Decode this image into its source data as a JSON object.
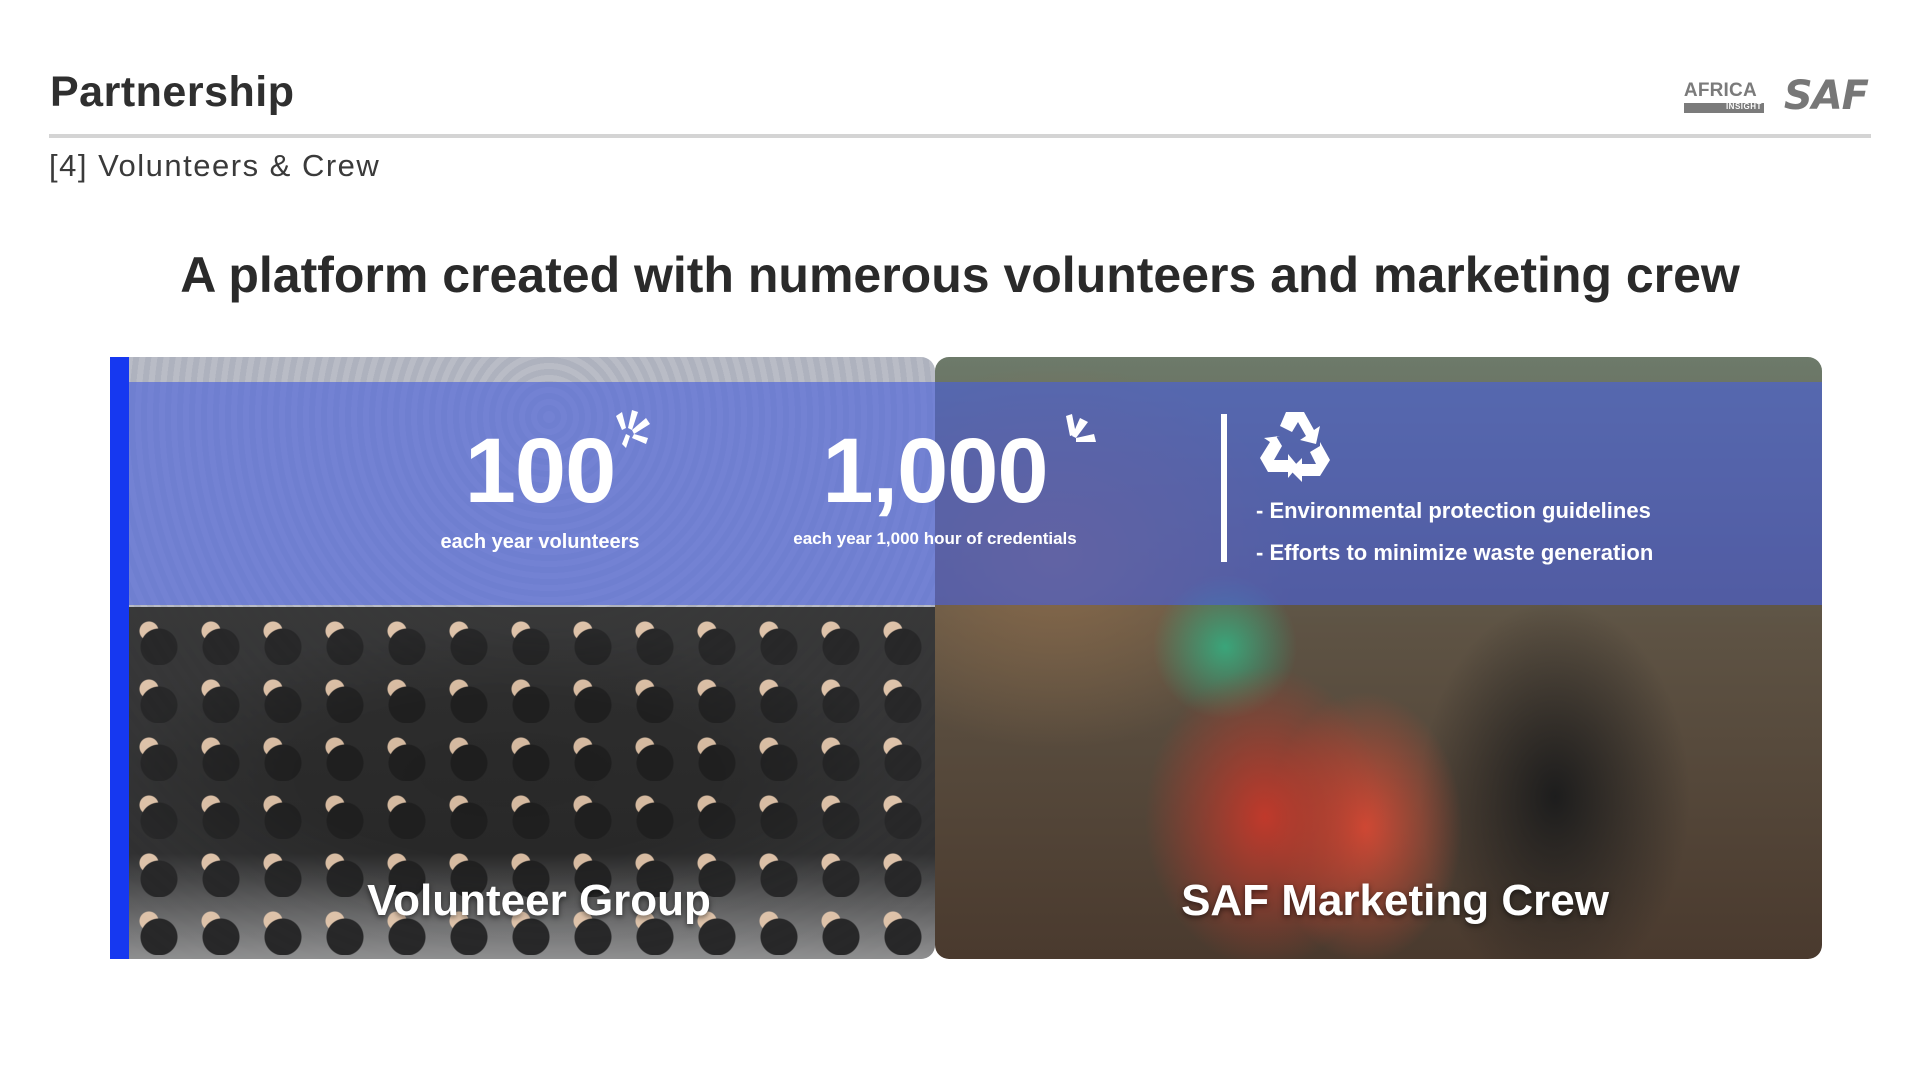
{
  "header": {
    "title": "Partnership",
    "subheading": "[4] Volunteers & Crew"
  },
  "logos": {
    "africa_word": "AFRICA",
    "africa_sub": "INSIGHT",
    "saf": "SAF"
  },
  "headline": "A platform created with numerous volunteers and marketing crew",
  "stats": [
    {
      "value": "100",
      "label": "each year volunteers"
    },
    {
      "value": "1,000",
      "label": "each year 1,000 hour of credentials"
    }
  ],
  "eco": {
    "items": [
      "- Environmental protection guidelines",
      "- Efforts to minimize waste generation"
    ]
  },
  "captions": {
    "left": "Volunteer Group",
    "right": "SAF Marketing Crew"
  },
  "colors": {
    "accent": "#1638f0",
    "overlay": "#4860dc",
    "title": "#2f2f2f"
  },
  "icons": {
    "stat_decoration": "sparkle-icon",
    "eco": "recycle-icon"
  }
}
